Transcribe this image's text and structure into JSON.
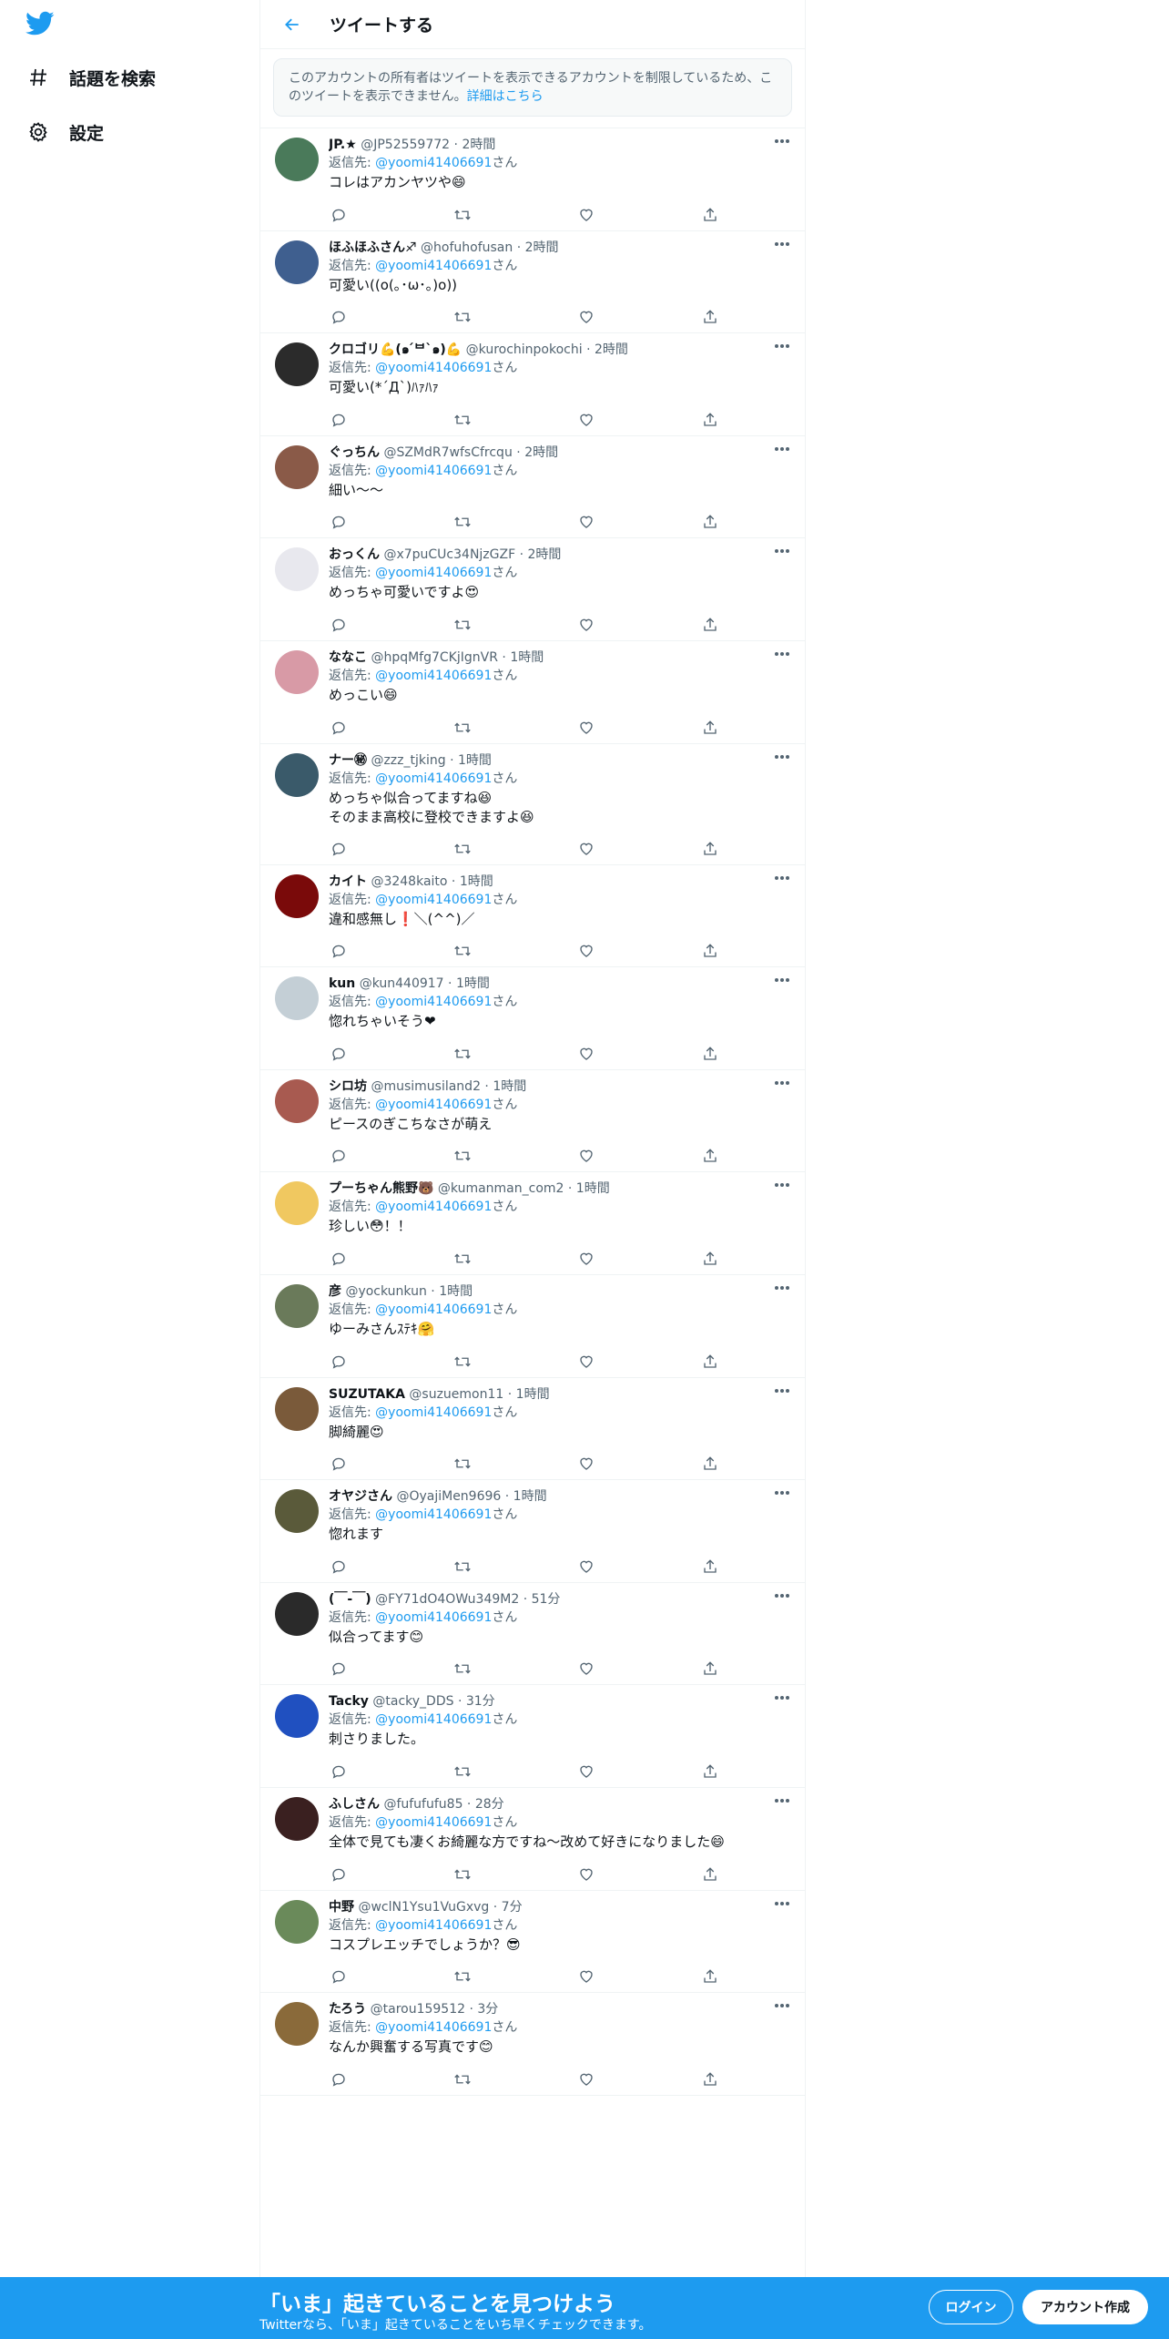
{
  "colors": {
    "accent": "#1d9bf0",
    "text": "#0f1419",
    "muted": "#536471",
    "border": "#eff3f4"
  },
  "nav": {
    "logo_icon": "twitter-bird-icon",
    "explore_label": "話題を検索",
    "settings_label": "設定"
  },
  "header": {
    "title": "ツイートする"
  },
  "notice": {
    "text": "このアカウントの所有者はツイートを表示できるアカウントを制限しているため、このツイートを表示できません。",
    "link": "詳細はこちら"
  },
  "reply_prefix": "返信先: ",
  "reply_suffix": "さん",
  "tweets": [
    {
      "name": "JP.★",
      "handle": "@JP52559772",
      "time": "2時間",
      "reply_to": "@yoomi41406691",
      "text": "コレはアカンヤツや😄",
      "avatar": "#4a7a5a"
    },
    {
      "name": "ほふほふさん♐",
      "handle": "@hofuhofusan",
      "time": "2時間",
      "reply_to": "@yoomi41406691",
      "text": "可愛い((o(｡･ω･｡)o))",
      "avatar": "#3f5f8f"
    },
    {
      "name": "クロゴリ💪(๑ ́ᄇ`๑)💪",
      "handle": "@kurochinpokochi",
      "time": "2時間",
      "reply_to": "@yoomi41406691",
      "text": "可愛い(*´Д`)ﾊｧﾊｧ",
      "avatar": "#2b2b2b"
    },
    {
      "name": "ぐっちん",
      "handle": "@SZMdR7wfsCfrcqu",
      "time": "2時間",
      "reply_to": "@yoomi41406691",
      "text": "細い〜〜",
      "avatar": "#8a5a48"
    },
    {
      "name": "おっくん",
      "handle": "@x7puCUc34NjzGZF",
      "time": "2時間",
      "reply_to": "@yoomi41406691",
      "text": "めっちゃ可愛いですよ😍",
      "avatar": "#e8e8ee"
    },
    {
      "name": "ななこ",
      "handle": "@hpqMfg7CKjIgnVR",
      "time": "1時間",
      "reply_to": "@yoomi41406691",
      "text": "めっこい😄",
      "avatar": "#d89aa6"
    },
    {
      "name": "ナー㊙",
      "handle": "@zzz_tjking",
      "time": "1時間",
      "reply_to": "@yoomi41406691",
      "text": "めっちゃ似合ってますね😆\nそのまま高校に登校できますよ😆",
      "avatar": "#3a5a6a"
    },
    {
      "name": "カイト",
      "handle": "@3248kaito",
      "time": "1時間",
      "reply_to": "@yoomi41406691",
      "text": "違和感無し❗＼(^^)／",
      "avatar": "#7a0a0a"
    },
    {
      "name": "kun",
      "handle": "@kun440917",
      "time": "1時間",
      "reply_to": "@yoomi41406691",
      "text": "惚れちゃいそう❤",
      "avatar": "#c4cfd6"
    },
    {
      "name": "シロ坊",
      "handle": "@musimusiland2",
      "time": "1時間",
      "reply_to": "@yoomi41406691",
      "text": "ピースのぎこちなさが萌え",
      "avatar": "#a85a50"
    },
    {
      "name": "プーちゃん熊野🐻",
      "handle": "@kumanman_com2",
      "time": "1時間",
      "reply_to": "@yoomi41406691",
      "text": "珍しい😳！！",
      "avatar": "#f0c860"
    },
    {
      "name": "彦",
      "handle": "@yockunkun",
      "time": "1時間",
      "reply_to": "@yoomi41406691",
      "text": "ゆーみさんｽﾃｷ🤗",
      "avatar": "#6a7a5a"
    },
    {
      "name": "SUZUTAKA",
      "handle": "@suzuemon11",
      "time": "1時間",
      "reply_to": "@yoomi41406691",
      "text": "脚綺麗😍",
      "avatar": "#7a5a3a"
    },
    {
      "name": "オヤジさん",
      "handle": "@OyajiMen9696",
      "time": "1時間",
      "reply_to": "@yoomi41406691",
      "text": "惚れます",
      "avatar": "#5a5a3a"
    },
    {
      "name": "(￣‐￣)",
      "handle": "@FY71dO4OWu349M2",
      "time": "51分",
      "reply_to": "@yoomi41406691",
      "text": "似合ってます😊",
      "avatar": "#2a2a2a"
    },
    {
      "name": "Tacky",
      "handle": "@tacky_DDS",
      "time": "31分",
      "reply_to": "@yoomi41406691",
      "text": "刺さりました。",
      "avatar": "#2050c0"
    },
    {
      "name": "ふしさん",
      "handle": "@fufufufu85",
      "time": "28分",
      "reply_to": "@yoomi41406691",
      "text": "全体で見ても凄くお綺麗な方ですね〜改めて好きになりました😄",
      "avatar": "#3a2020"
    },
    {
      "name": "中野",
      "handle": "@wclN1Ysu1VuGxvg",
      "time": "7分",
      "reply_to": "@yoomi41406691",
      "text": "コスプレエッチでしょうか？😎",
      "avatar": "#6a8a5a"
    },
    {
      "name": "たろう",
      "handle": "@tarou159512",
      "time": "3分",
      "reply_to": "@yoomi41406691",
      "text": "なんか興奮する写真です😊",
      "avatar": "#8a6a3a"
    }
  ],
  "bottom": {
    "title": "「いま」起きていることを見つけよう",
    "subtitle": "Twitterなら、「いま」起きていることをいち早くチェックできます。",
    "login": "ログイン",
    "signup": "アカウント作成"
  }
}
